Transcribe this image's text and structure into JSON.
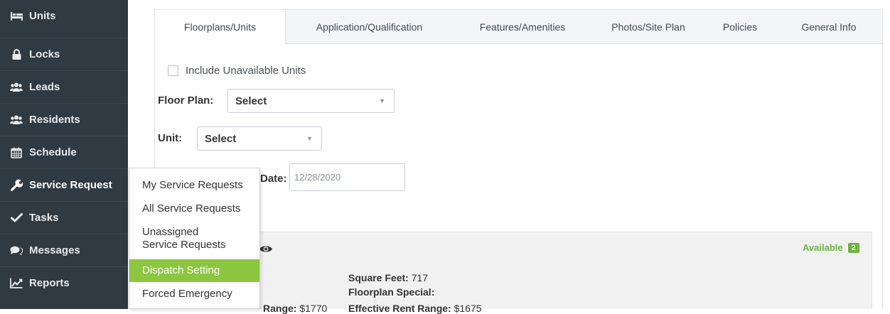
{
  "sidebar": {
    "items": [
      {
        "label": "Units",
        "icon": "bed-icon"
      },
      {
        "label": "Locks",
        "icon": "lock-icon"
      },
      {
        "label": "Leads",
        "icon": "users-icon"
      },
      {
        "label": "Residents",
        "icon": "users-icon"
      },
      {
        "label": "Schedule",
        "icon": "calendar-icon"
      },
      {
        "label": "Service Request",
        "icon": "wrench-icon"
      },
      {
        "label": "Tasks",
        "icon": "check-icon"
      },
      {
        "label": "Messages",
        "icon": "comments-icon"
      },
      {
        "label": "Reports",
        "icon": "line-chart-icon"
      }
    ]
  },
  "tabs": [
    {
      "label": "Floorplans/Units",
      "active": true
    },
    {
      "label": "Application/Qualification",
      "active": false
    },
    {
      "label": "Features/Amenities",
      "active": false
    },
    {
      "label": "Photos/Site Plan",
      "active": false
    },
    {
      "label": "Policies",
      "active": false
    },
    {
      "label": "General Info",
      "active": false
    }
  ],
  "form": {
    "include_unavailable_label": "Include Unavailable Units",
    "include_unavailable_checked": false,
    "floor_plan_label": "Floor Plan:",
    "floor_plan_value": "Select",
    "unit_label": "Unit:",
    "unit_value": "Select",
    "date_label": "Date:",
    "date_value": "12/28/2020"
  },
  "floorplan": {
    "availability_label": "Available",
    "availability_count": "2",
    "square_feet_label": "Square Feet:",
    "square_feet_value": "717",
    "special_label": "Floorplan Special:",
    "rent_range_label_partial": "Range:",
    "rent_range_value": "$1770",
    "effective_rent_label": "Effective Rent Range:",
    "effective_rent_value": "$1675"
  },
  "service_menu": {
    "items": [
      {
        "label": "My Service Requests",
        "highlighted": false
      },
      {
        "label": "All Service Requests",
        "highlighted": false
      },
      {
        "label": "Unassigned Service Requests",
        "line1": "Unassigned",
        "line2": "Service Requests",
        "highlighted": false
      },
      {
        "label": "Dispatch Setting",
        "highlighted": true
      },
      {
        "label": "Forced Emergency",
        "highlighted": false
      }
    ]
  },
  "colors": {
    "sidebar_bg": "#2f3a42",
    "accent_green": "#8cc63f",
    "available_green": "#6db33f"
  }
}
